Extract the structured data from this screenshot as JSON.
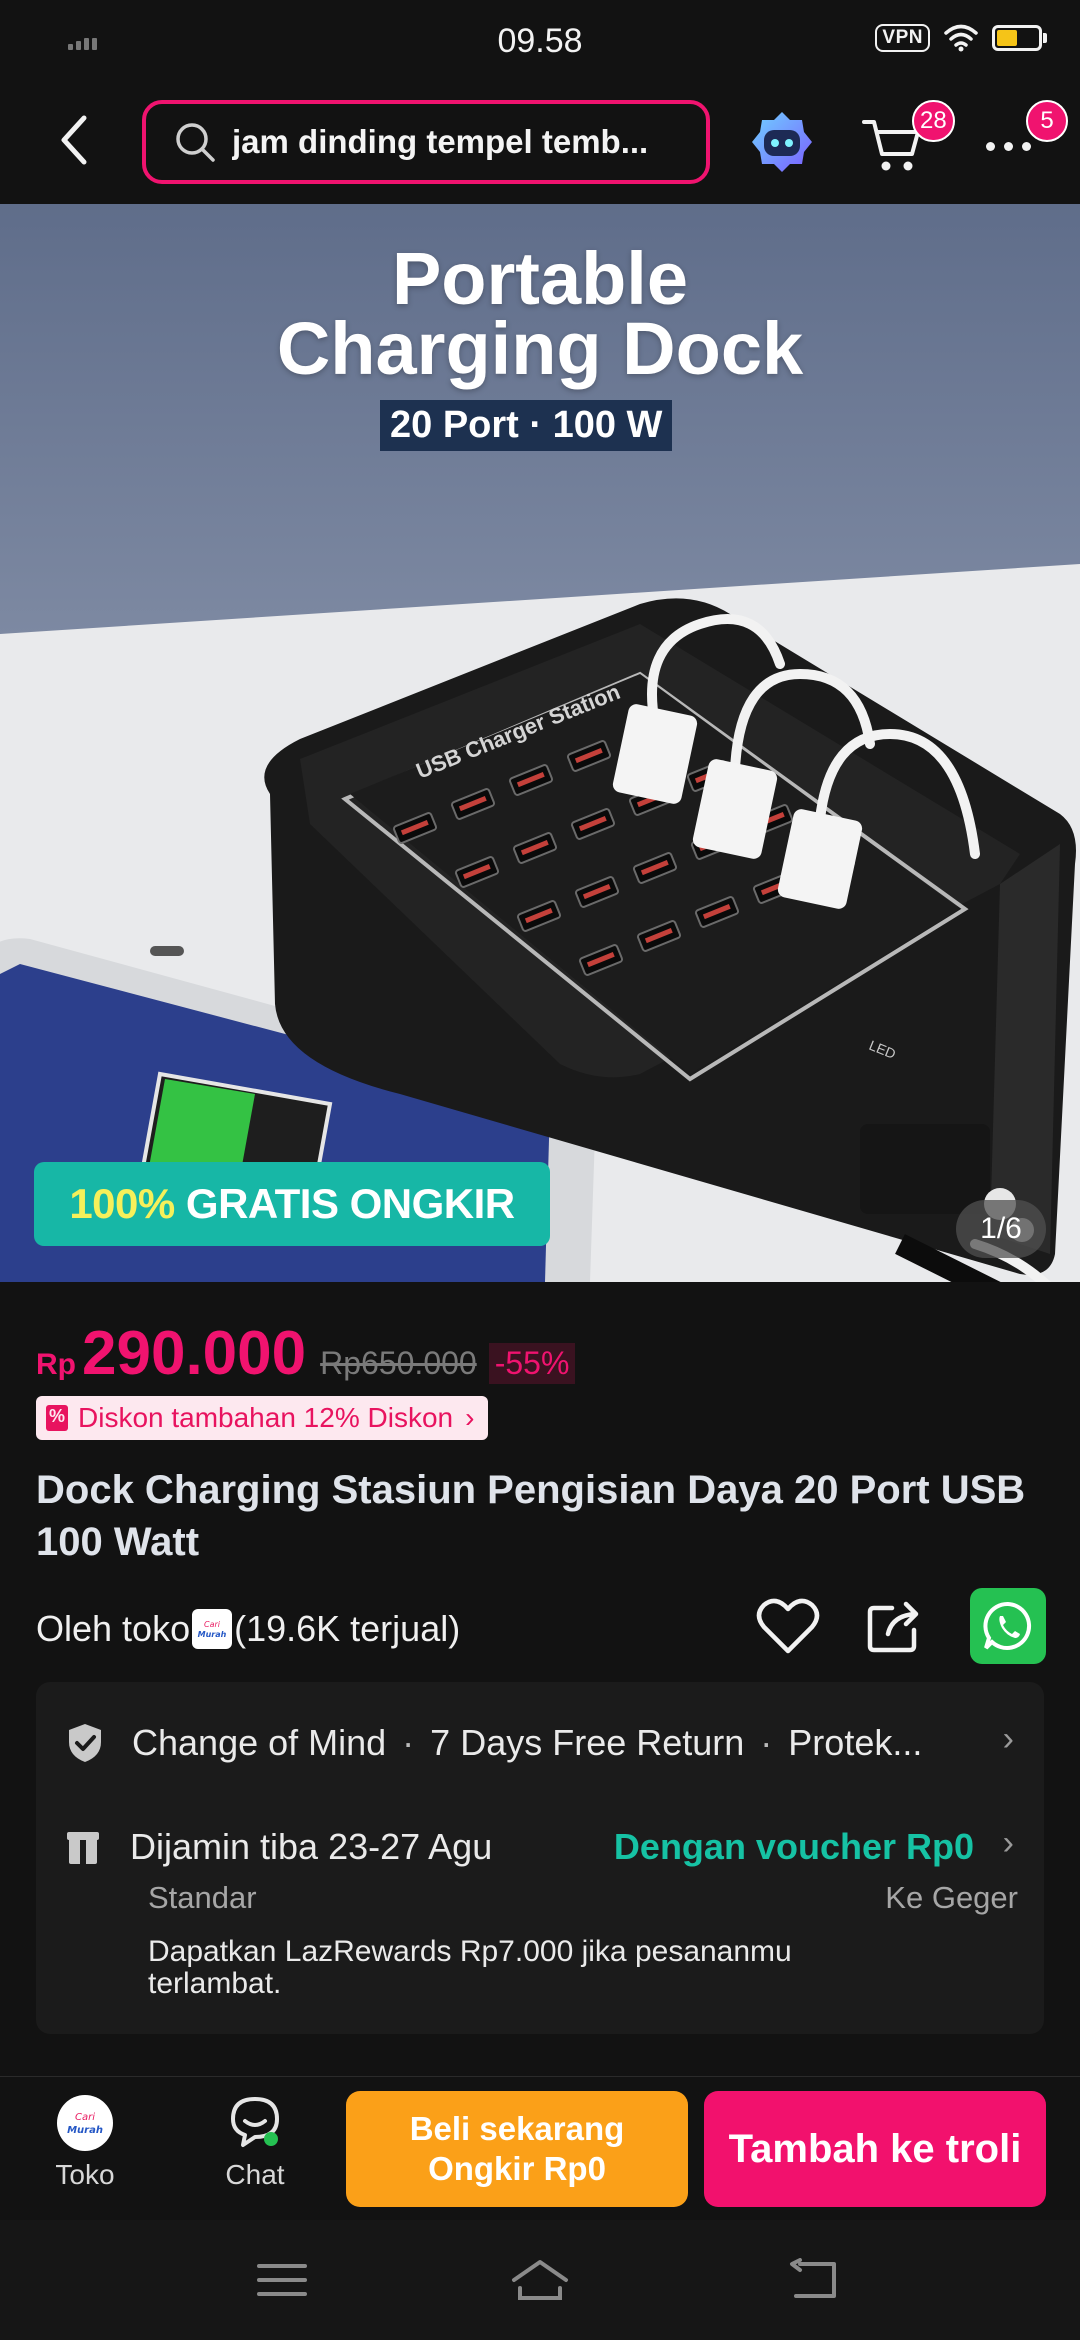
{
  "status_bar": {
    "time": "09.58",
    "vpn_label": "VPN",
    "battery_level": 0.55,
    "battery_color": "#f5c418"
  },
  "header": {
    "search_query": "jam dinding tempel temb...",
    "cart_count": "28",
    "more_count": "5",
    "icons": [
      "back-arrow-icon",
      "search-icon",
      "assistant-robot-icon",
      "cart-icon",
      "more-dots-icon"
    ]
  },
  "hero": {
    "title_line1": "Portable",
    "title_line2": "Charging Dock",
    "subtitle": "20 Port · 100 W",
    "device_label": "USB Charger Station",
    "led_label": "LED",
    "promo_highlight": "100%",
    "promo_text": "GRATIS ONGKIR",
    "page_indicator": "1/6"
  },
  "product": {
    "currency": "Rp",
    "price": "290.000",
    "old_price": "Rp650.000",
    "discount": "-55%",
    "voucher_text": "Diskon tambahan 12% Diskon",
    "title": "Dock Charging Stasiun Pengisian Daya 20 Port USB 100 Watt",
    "seller_prefix": "Oleh toko",
    "sold": "(19.6K terjual)",
    "store_logo_text": "Cari Murah"
  },
  "info": {
    "guarantee_items": [
      "Change of Mind",
      "7 Days Free Return",
      "Protek..."
    ],
    "delivery_text": "Dijamin tiba 23-27 Agu",
    "delivery_voucher": "Dengan voucher Rp0",
    "shipping_type": "Standar",
    "destination": "Ke Geger",
    "lazrewards": "Dapatkan LazRewards Rp7.000 jika pesananmu terlambat."
  },
  "bottom_bar": {
    "toko_label": "Toko",
    "chat_label": "Chat",
    "buy_line1": "Beli sekarang",
    "buy_line2": "Ongkir Rp0",
    "cart_button": "Tambah ke troli"
  },
  "colors": {
    "accent_pink": "#f0136f",
    "teal": "#16c2a4",
    "orange": "#fba018",
    "whatsapp_green": "#25c152"
  }
}
